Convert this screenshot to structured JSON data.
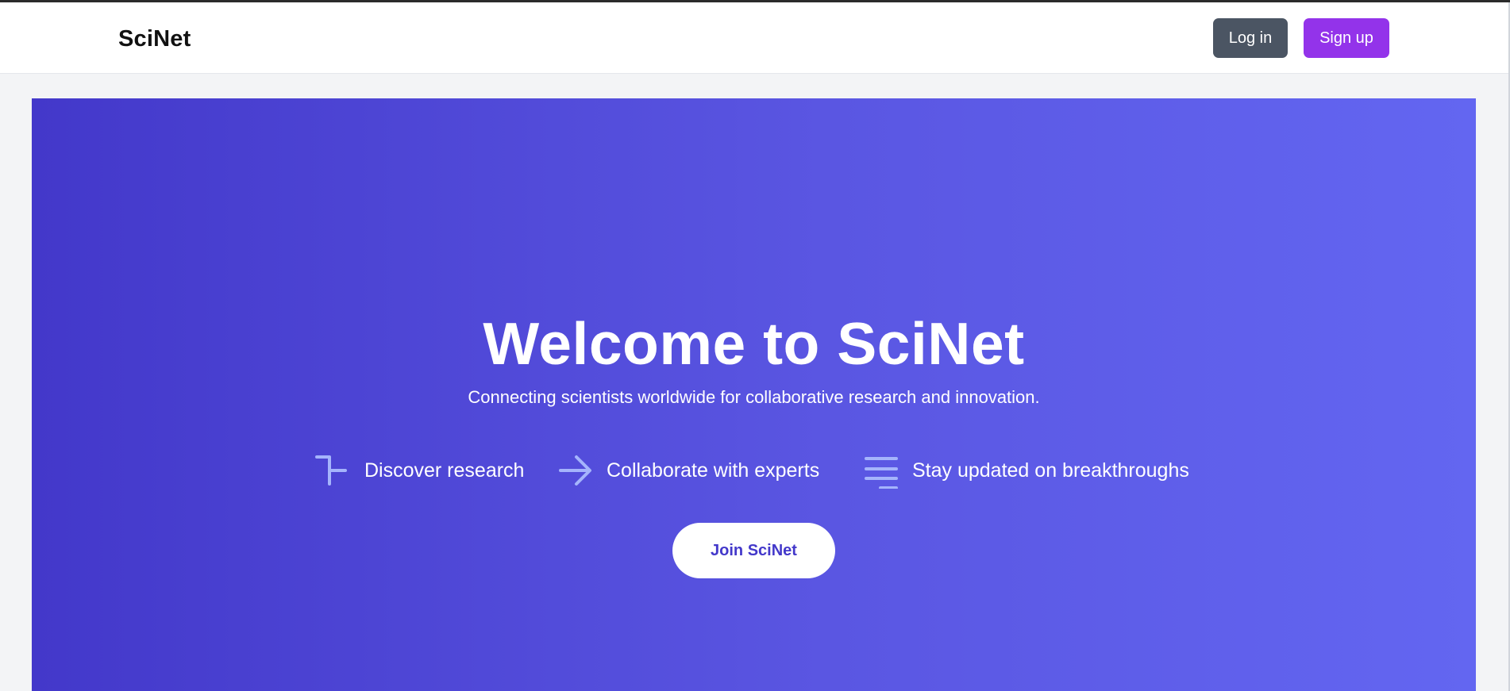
{
  "navbar": {
    "brand": "SciNet",
    "login_label": "Log in",
    "signup_label": "Sign up"
  },
  "hero": {
    "title": "Welcome to SciNet",
    "subtitle": "Connecting scientists worldwide for collaborative research and innovation.",
    "features": [
      {
        "icon": "corner-line-icon",
        "label": "Discover research"
      },
      {
        "icon": "arrow-right-icon",
        "label": "Collaborate with experts"
      },
      {
        "icon": "lines-icon",
        "label": "Stay updated on breakthroughs"
      }
    ],
    "cta_label": "Join SciNet"
  },
  "colors": {
    "hero_gradient_start": "#4338ca",
    "hero_gradient_end": "#6366f1",
    "login_button": "#4b5563",
    "signup_button": "#9333ea",
    "cta_text": "#4338ca",
    "icon_color": "#a5b4fc"
  }
}
